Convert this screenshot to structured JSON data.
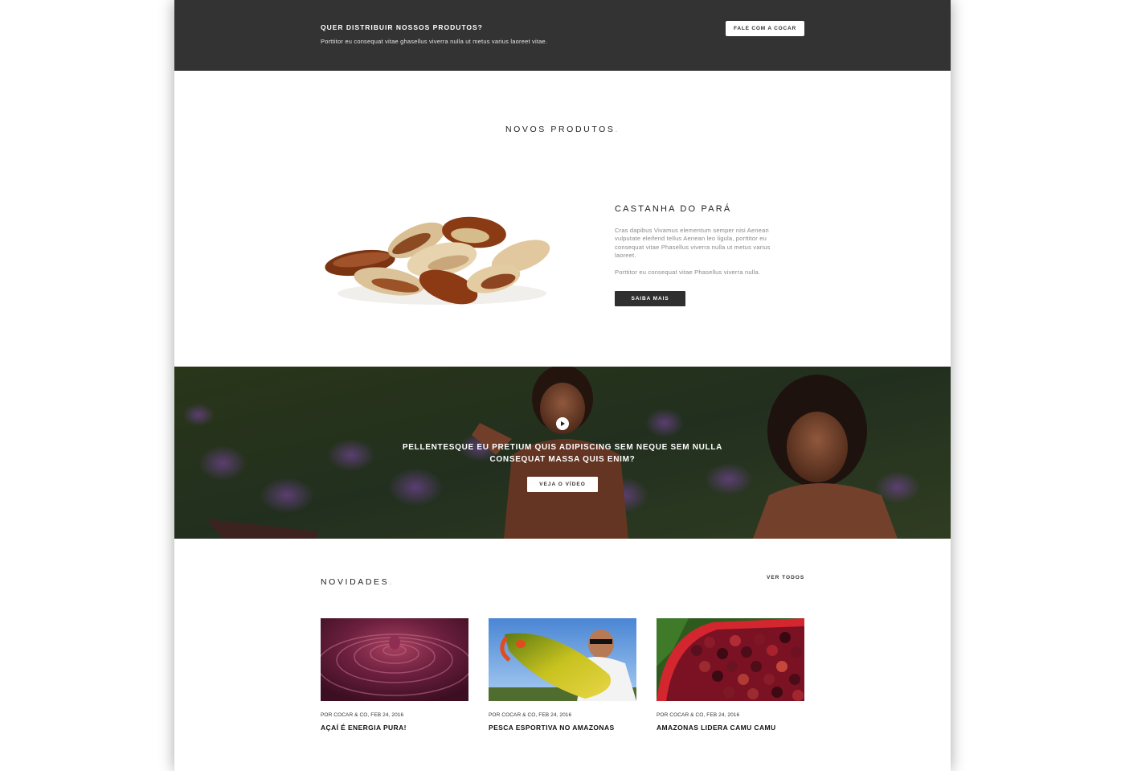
{
  "distributor_bar": {
    "title": "QUER DISTRIBUIR NOSSOS PRODUTOS?",
    "subtitle": "Porttitor eu consequat vitae ghasellus viverra nulla ut metus varius laoreet vitae.",
    "cta_label": "FALE COM A COCAR"
  },
  "products_section": {
    "title": "NOVOS PRODUTOS",
    "title_dot": ".",
    "product": {
      "name": "CASTANHA DO PARÁ",
      "description": "Cras dapibus Vivamus elementum semper nisi Aenean vulputate eleifend tellus Aenean leo ligula, porttitor eu consequat vitae Phasellus viverra nulla ut metus varius laoreet.",
      "description_2": "Porttitor eu consequat vitae Phasellus viverra nulla.",
      "cta_label": "SAIBA MAIS",
      "image_icon": "brazil-nuts-photo"
    }
  },
  "video_banner": {
    "play_icon": "play-icon",
    "headline_line1": "PELLENTESQUE EU PRETIUM QUIS ADIPISCING SEM NEQUE SEM NULLA",
    "headline_line2": "CONSEQUAT MASSA QUIS ENIM?",
    "cta_label": "VEJA O VÍDEO"
  },
  "news_section": {
    "title": "NOVIDADES",
    "title_dot": ".",
    "see_all_label": "VER TODOS",
    "items": [
      {
        "meta": "POR COCAR & CO, FEB 24, 2016",
        "title": "AÇAÍ É ENERGIA PURA!",
        "image_icon": "acai-photo"
      },
      {
        "meta": "POR COCAR & CO, FEB 24, 2016",
        "title": "PESCA ESPORTIVA NO AMAZONAS",
        "image_icon": "fishing-photo"
      },
      {
        "meta": "POR COCAR & CO, FEB 24, 2016",
        "title": "AMAZONAS LIDERA CAMU CAMU",
        "image_icon": "camu-camu-photo"
      }
    ]
  },
  "colors": {
    "dark_bar": "#333333",
    "button_dark": "#2f2f2f",
    "text_muted": "#888888"
  }
}
